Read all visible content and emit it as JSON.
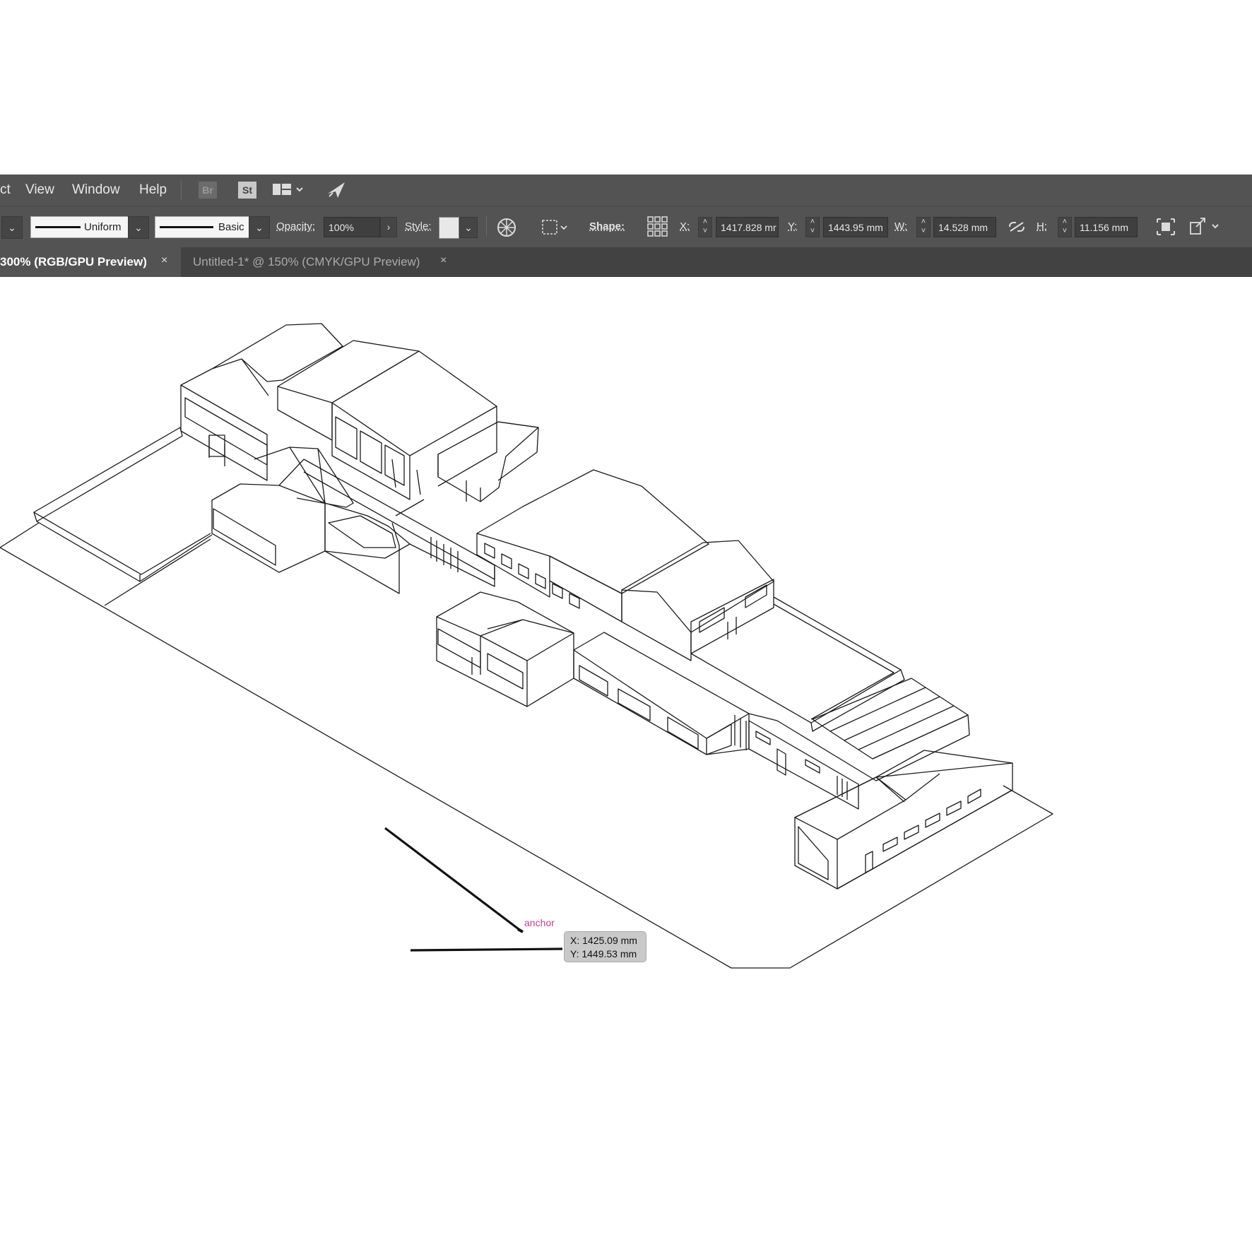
{
  "menubar": {
    "items": [
      "ct",
      "View",
      "Window",
      "Help"
    ],
    "bridge_label": "Br",
    "stock_label": "St"
  },
  "control_bar": {
    "stroke_profile": "Uniform",
    "brush": "Basic",
    "opacity_label": "Opacity:",
    "opacity_value": "100%",
    "style_label": "Style:",
    "shape_label": "Shape:",
    "x_label": "X:",
    "x_value": "1417.828 mr",
    "y_label": "Y:",
    "y_value": "1443.95 mm",
    "w_label": "W:",
    "w_value": "14.528 mm",
    "h_label": "H:",
    "h_value": "11.156 mm"
  },
  "tabs": [
    {
      "label": "300% (RGB/GPU Preview)",
      "close": "×",
      "active": true
    },
    {
      "label": "Untitled-1* @ 150% (CMYK/GPU Preview)",
      "close": "×",
      "active": false
    }
  ],
  "canvas": {
    "anchor_hint": "anchor",
    "readout_x": "X: 1425.09 mm",
    "readout_y": "Y: 1449.53 mm"
  },
  "colors": {
    "ui_dark": "#535353",
    "tab_bar": "#424242",
    "smart_guide": "#c0408f"
  }
}
